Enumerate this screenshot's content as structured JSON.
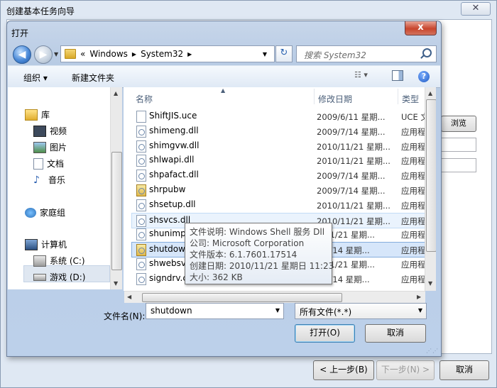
{
  "wizard": {
    "title": "创建基本任务向导",
    "close_glyph": "✕",
    "browse_label": "浏览(R)...",
    "back_label": "< 上一步(B)",
    "next_label": "下一步(N) >",
    "cancel_label": "取消"
  },
  "dialog": {
    "title": "打开",
    "close_glyph": "x",
    "address": {
      "prefix": "«",
      "crumbs": [
        "Windows",
        "System32"
      ]
    },
    "search_placeholder": "搜索 System32",
    "toolbar": {
      "organize": "组织 ▾",
      "new_folder": "新建文件夹"
    },
    "nav": {
      "libraries": "库",
      "library_items": [
        "视频",
        "图片",
        "文档",
        "音乐"
      ],
      "homegroup": "家庭组",
      "computer": "计算机",
      "drives": [
        "系统 (C:)",
        "游戏 (D:)"
      ]
    },
    "columns": {
      "name": "名称",
      "date": "修改日期",
      "type": "类型"
    },
    "files": [
      {
        "name": "ShiftJIS.uce",
        "date": "2009/6/11 星期...",
        "type": "UCE 文件",
        "icon": "plain-file-icon"
      },
      {
        "name": "shimeng.dll",
        "date": "2009/7/14 星期...",
        "type": "应用程序扩展",
        "icon": "dll-icon"
      },
      {
        "name": "shimgvw.dll",
        "date": "2010/11/21 星期...",
        "type": "应用程序扩展",
        "icon": "dll-icon"
      },
      {
        "name": "shlwapi.dll",
        "date": "2010/11/21 星期...",
        "type": "应用程序扩展",
        "icon": "dll-icon"
      },
      {
        "name": "shpafact.dll",
        "date": "2009/7/14 星期...",
        "type": "应用程序扩展",
        "icon": "dll-icon"
      },
      {
        "name": "shrpubw",
        "date": "2009/7/14 星期...",
        "type": "应用程序",
        "icon": "exe-icon"
      },
      {
        "name": "shsetup.dll",
        "date": "2010/11/21 星期...",
        "type": "应用程序扩展",
        "icon": "dll-icon"
      },
      {
        "name": "shsvcs.dll",
        "date": "2010/11/21 星期...",
        "type": "应用程序扩展",
        "icon": "dll-icon"
      },
      {
        "name": "shunimp",
        "date": "0/11/21 星期...",
        "type": "应用程序扩展",
        "icon": "dll-icon"
      },
      {
        "name": "shutdow",
        "date": "9/7/14 星期...",
        "type": "应用程序",
        "icon": "exe-icon"
      },
      {
        "name": "shwebsv",
        "date": "0/11/21 星期...",
        "type": "应用程序扩展",
        "icon": "dll-icon"
      },
      {
        "name": "signdrv.c",
        "date": "9/7/14 星期...",
        "type": "应用程序扩展",
        "icon": "dll-icon"
      }
    ],
    "tooltip": [
      "文件说明: Windows Shell 服务 Dll",
      "公司: Microsoft Corporation",
      "文件版本: 6.1.7601.17514",
      "创建日期: 2010/11/21 星期日 11:23",
      "大小: 362 KB"
    ],
    "filename_label": "文件名(N):",
    "filename_value": "shutdown",
    "filetype_value": "所有文件(*.*)",
    "open_label": "打开(O)",
    "cancel_label": "取消"
  }
}
